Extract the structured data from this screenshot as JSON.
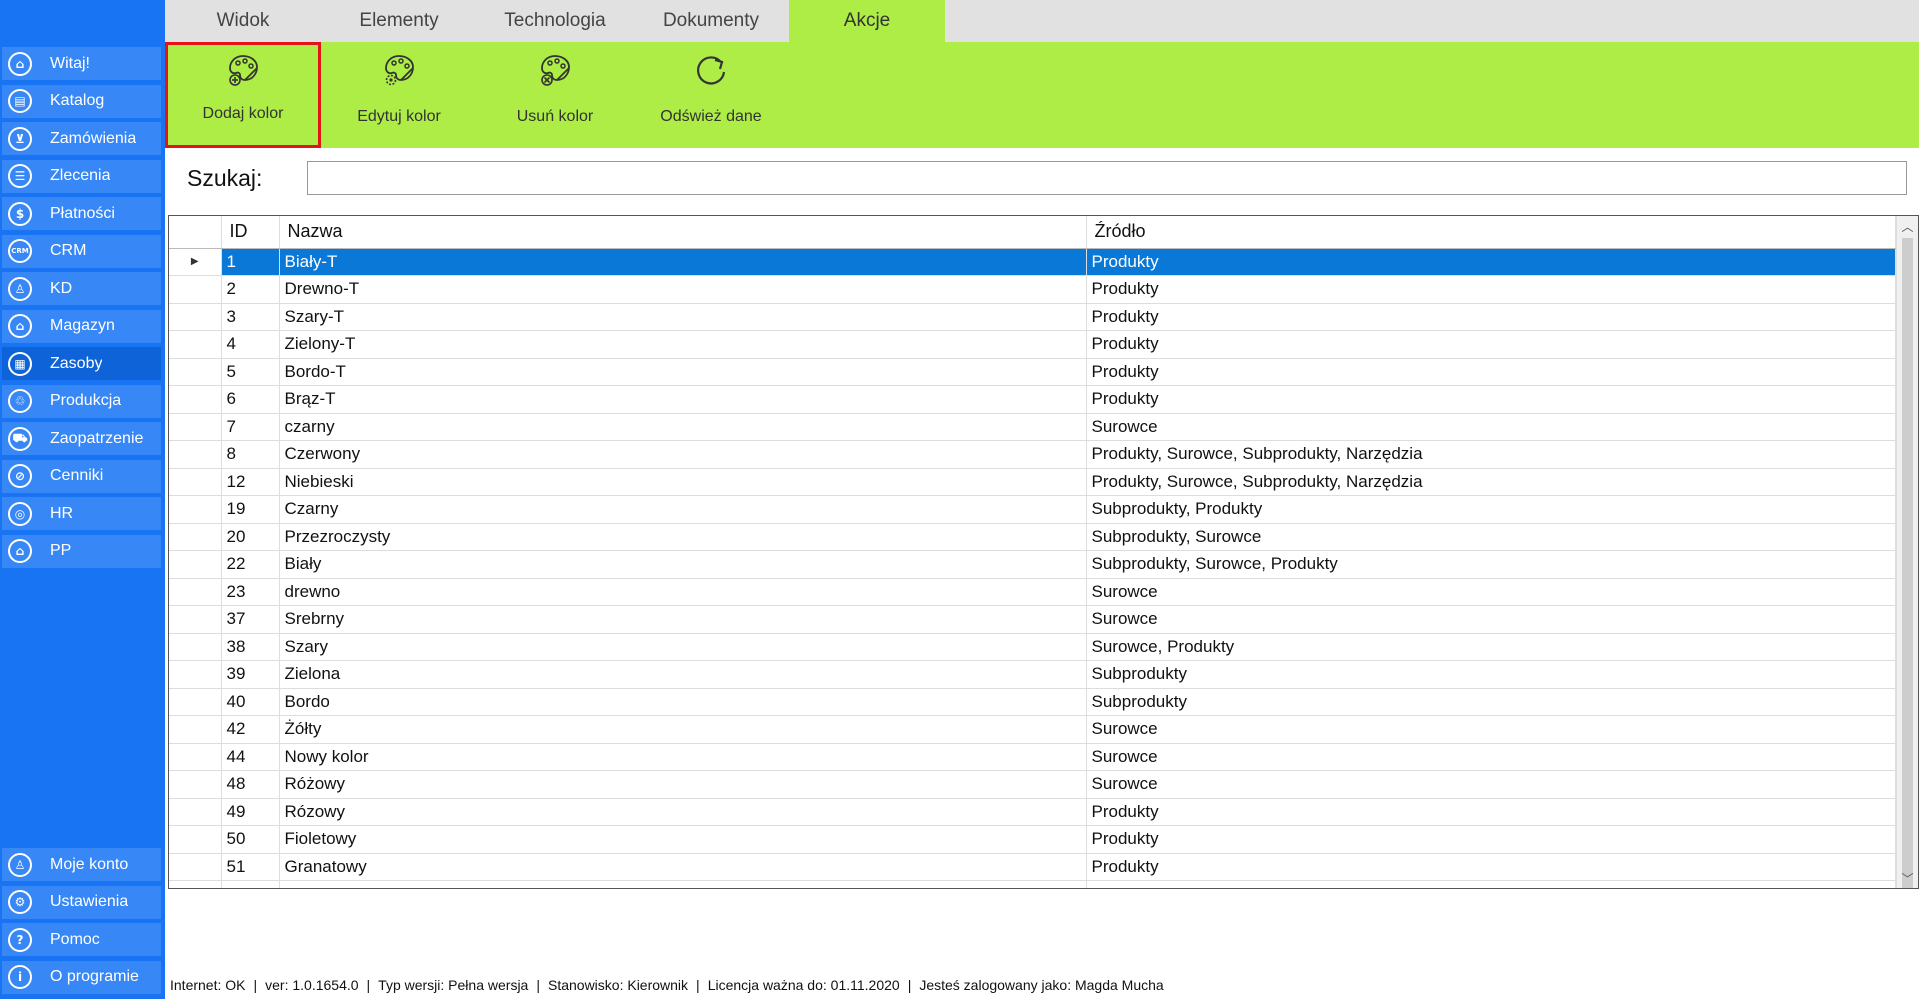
{
  "sidebar": {
    "items": [
      {
        "label": "Witaj!",
        "icon": "home-icon",
        "glyph": "⌂"
      },
      {
        "label": "Katalog",
        "icon": "book-icon",
        "glyph": "▤"
      },
      {
        "label": "Zamówienia",
        "icon": "cart-icon",
        "glyph": "⊻"
      },
      {
        "label": "Zlecenia",
        "icon": "list-icon",
        "glyph": "☰"
      },
      {
        "label": "Płatności",
        "icon": "dollar-icon",
        "glyph": "$"
      },
      {
        "label": "CRM",
        "icon": "crm-icon",
        "glyph": "CRM"
      },
      {
        "label": "KD",
        "icon": "person-icon",
        "glyph": "♙"
      },
      {
        "label": "Magazyn",
        "icon": "warehouse-icon",
        "glyph": "⌂"
      },
      {
        "label": "Zasoby",
        "icon": "resources-icon",
        "glyph": "▦"
      },
      {
        "label": "Produkcja",
        "icon": "production-icon",
        "glyph": "♲"
      },
      {
        "label": "Zaopatrzenie",
        "icon": "truck-icon",
        "glyph": "⛟"
      },
      {
        "label": "Cenniki",
        "icon": "price-tag-icon",
        "glyph": "⊘"
      },
      {
        "label": "HR",
        "icon": "fingerprint-icon",
        "glyph": "◎"
      },
      {
        "label": "PP",
        "icon": "factory-icon",
        "glyph": "⌂"
      }
    ],
    "bottom_items": [
      {
        "label": "Moje konto",
        "icon": "user-account-icon",
        "glyph": "♙"
      },
      {
        "label": "Ustawienia",
        "icon": "settings-icon",
        "glyph": "⚙"
      },
      {
        "label": "Pomoc",
        "icon": "help-icon",
        "glyph": "?"
      },
      {
        "label": "O programie",
        "icon": "info-icon",
        "glyph": "i"
      }
    ]
  },
  "tabs": [
    {
      "label": "Widok"
    },
    {
      "label": "Elementy"
    },
    {
      "label": "Technologia"
    },
    {
      "label": "Dokumenty"
    },
    {
      "label": "Akcje"
    }
  ],
  "ribbon": {
    "add_color": "Dodaj kolor",
    "edit_color": "Edytuj kolor",
    "delete_color": "Usuń kolor",
    "refresh": "Odśwież dane"
  },
  "search": {
    "label": "Szukaj:",
    "value": ""
  },
  "grid": {
    "columns": {
      "id": "ID",
      "name": "Nazwa",
      "source": "Źródło"
    },
    "rows": [
      {
        "id": "1",
        "name": "Biały-T",
        "source": "Produkty"
      },
      {
        "id": "2",
        "name": "Drewno-T",
        "source": "Produkty"
      },
      {
        "id": "3",
        "name": "Szary-T",
        "source": "Produkty"
      },
      {
        "id": "4",
        "name": "Zielony-T",
        "source": "Produkty"
      },
      {
        "id": "5",
        "name": "Bordo-T",
        "source": "Produkty"
      },
      {
        "id": "6",
        "name": "Brąz-T",
        "source": "Produkty"
      },
      {
        "id": "7",
        "name": "czarny",
        "source": "Surowce"
      },
      {
        "id": "8",
        "name": "Czerwony",
        "source": "Produkty, Surowce, Subprodukty, Narzędzia"
      },
      {
        "id": "12",
        "name": "Niebieski",
        "source": "Produkty, Surowce, Subprodukty, Narzędzia"
      },
      {
        "id": "19",
        "name": "Czarny",
        "source": "Subprodukty, Produkty"
      },
      {
        "id": "20",
        "name": "Przezroczysty",
        "source": "Subprodukty, Surowce"
      },
      {
        "id": "22",
        "name": "Biały",
        "source": "Subprodukty, Surowce, Produkty"
      },
      {
        "id": "23",
        "name": "drewno",
        "source": "Surowce"
      },
      {
        "id": "37",
        "name": "Srebrny",
        "source": "Surowce"
      },
      {
        "id": "38",
        "name": "Szary",
        "source": "Surowce, Produkty"
      },
      {
        "id": "39",
        "name": "Zielona",
        "source": "Subprodukty"
      },
      {
        "id": "40",
        "name": "Bordo",
        "source": "Subprodukty"
      },
      {
        "id": "42",
        "name": "Żółty",
        "source": "Surowce"
      },
      {
        "id": "44",
        "name": "Nowy kolor",
        "source": "Surowce"
      },
      {
        "id": "48",
        "name": "Różowy",
        "source": "Surowce"
      },
      {
        "id": "49",
        "name": "Rózowy",
        "source": "Produkty"
      },
      {
        "id": "50",
        "name": "Fioletowy",
        "source": "Produkty"
      },
      {
        "id": "51",
        "name": "Granatowy",
        "source": "Produkty"
      },
      {
        "id": "",
        "name": "",
        "source": ""
      }
    ]
  },
  "status": {
    "internet": "Internet: OK",
    "version": "ver: 1.0.1654.0",
    "version_type": "Typ wersji: Pełna wersja",
    "position": "Stanowisko: Kierownik",
    "license": "Licencja ważna do: 01.11.2020",
    "user": "Jesteś zalogowany jako: Magda Mucha"
  },
  "colors": {
    "sidebar_bg": "#1874f2",
    "sidebar_item": "#3787f6",
    "accent_green": "#aded46",
    "selection_blue": "#0a78d7",
    "highlight_red": "#e6121a"
  }
}
